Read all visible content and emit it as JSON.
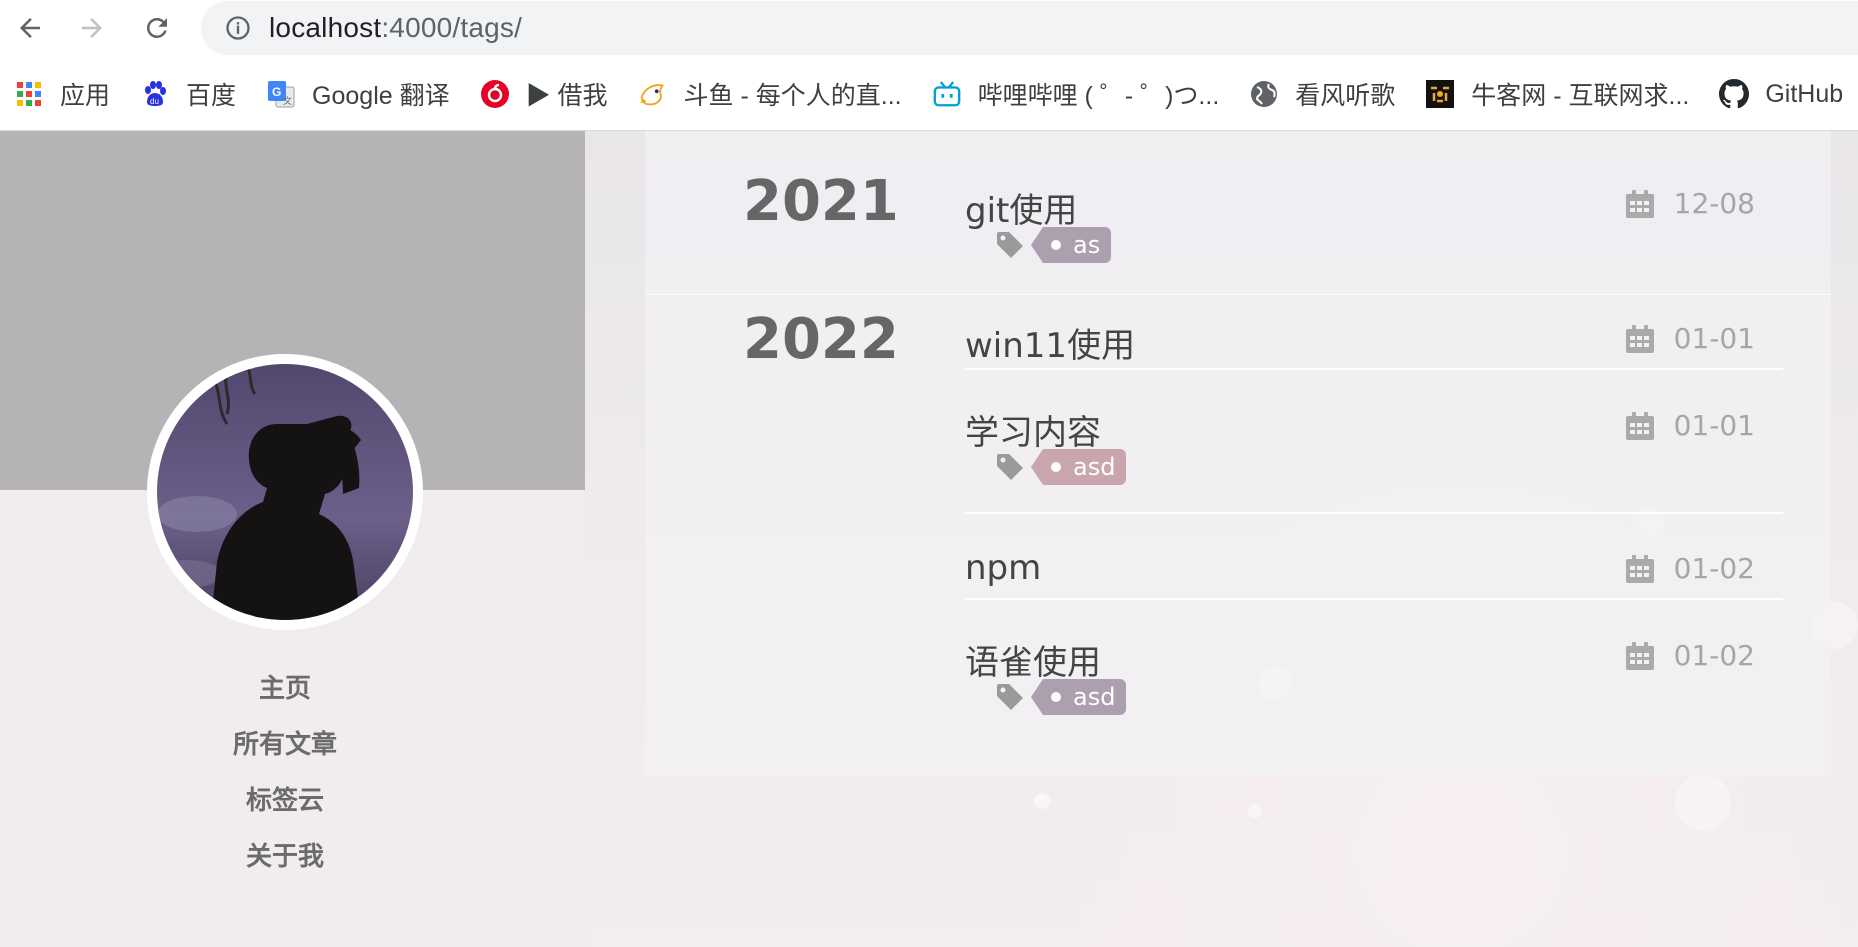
{
  "browser": {
    "url_host": "localhost",
    "url_path": ":4000/tags/",
    "bookmarks": [
      {
        "label": "应用",
        "icon": "apps-grid-icon"
      },
      {
        "label": "百度",
        "icon": "baidu-paw-icon"
      },
      {
        "label": "Google 翻译",
        "icon": "google-translate-icon"
      },
      {
        "label": "▶ 借我",
        "icon": "netease-music-icon"
      },
      {
        "label": "斗鱼 - 每个人的直...",
        "icon": "douyu-fish-icon"
      },
      {
        "label": "哔哩哔哩 ( ゜- ゜)つ...",
        "icon": "bilibili-tv-icon"
      },
      {
        "label": "看风听歌",
        "icon": "globe-icon"
      },
      {
        "label": "牛客网 - 互联网求...",
        "icon": "nowcoder-icon"
      },
      {
        "label": "GitHub",
        "icon": "github-icon"
      }
    ]
  },
  "sidebar": {
    "menu": [
      "主页",
      "所有文章",
      "标签云",
      "关于我"
    ]
  },
  "archive": [
    {
      "year": "2021",
      "posts": [
        {
          "title": "git使用",
          "date": "12-08",
          "tag": "as"
        }
      ]
    },
    {
      "year": "2022",
      "posts": [
        {
          "title": "win11使用",
          "date": "01-01"
        },
        {
          "title": "学习内容",
          "date": "01-01",
          "tag": "asd"
        },
        {
          "title": "npm",
          "date": "01-02"
        },
        {
          "title": "语雀使用",
          "date": "01-02",
          "tag": "asd"
        }
      ]
    }
  ],
  "colors": {
    "tag_purple": "#ab9fb0",
    "tag_pink": "#c9a6ad",
    "cover_gray": "#b6b3b6"
  }
}
